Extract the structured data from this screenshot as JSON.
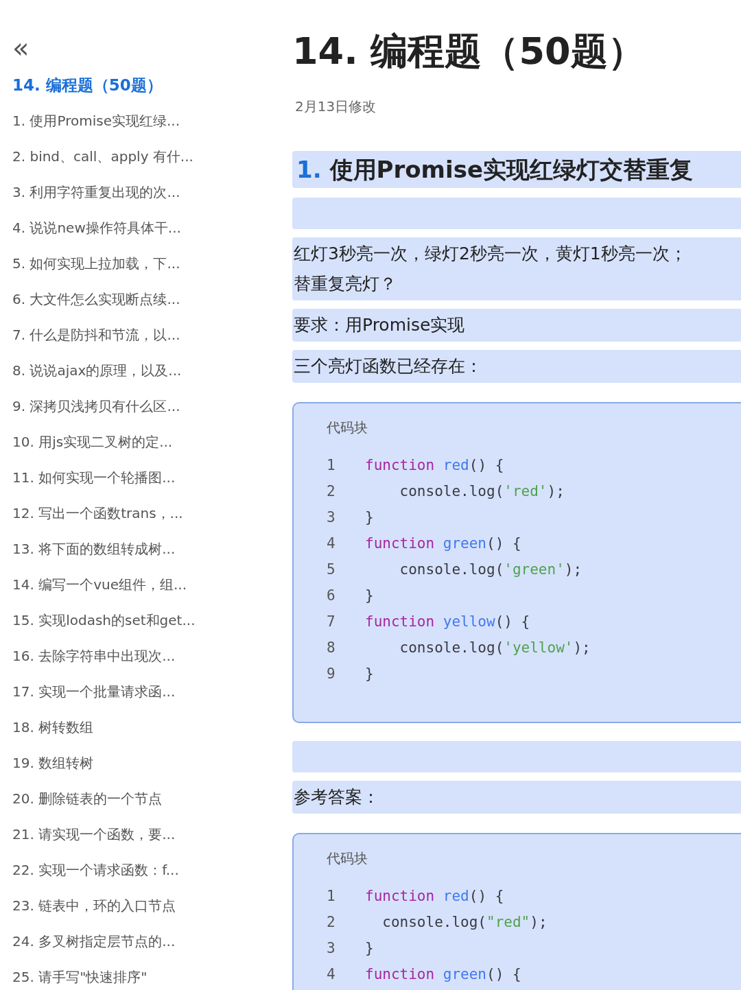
{
  "sidebar": {
    "collapse_icon": "«",
    "title": "14. 编程题（50题）",
    "items": [
      {
        "label": "1. 使用Promise实现红绿...",
        "selected": false
      },
      {
        "label": "2. bind、call、apply 有什...",
        "selected": false
      },
      {
        "label": "3. 利用字符重复出现的次...",
        "selected": false
      },
      {
        "label": "4. 说说new操作符具体干...",
        "selected": false
      },
      {
        "label": "5. 如何实现上拉加载，下...",
        "selected": false
      },
      {
        "label": "6. 大文件怎么实现断点续...",
        "selected": false
      },
      {
        "label": "7. 什么是防抖和节流，以...",
        "selected": false
      },
      {
        "label": "8. 说说ajax的原理，以及...",
        "selected": false
      },
      {
        "label": "9. 深拷贝浅拷贝有什么区...",
        "selected": false
      },
      {
        "label": "10. 用js实现二叉树的定...",
        "selected": false
      },
      {
        "label": "11. 如何实现一个轮播图...",
        "selected": false
      },
      {
        "label": "12. 写出一个函数trans，...",
        "selected": false
      },
      {
        "label": "13. 将下面的数组转成树...",
        "selected": false
      },
      {
        "label": "14. 编写一个vue组件，组...",
        "selected": false
      },
      {
        "label": "15. 实现lodash的set和get...",
        "selected": false
      },
      {
        "label": "16. 去除字符串中出现次...",
        "selected": false
      },
      {
        "label": "17. 实现一个批量请求函...",
        "selected": false
      },
      {
        "label": "18. 树转数组",
        "selected": false
      },
      {
        "label": "19. 数组转树",
        "selected": false
      },
      {
        "label": "20. 删除链表的一个节点",
        "selected": false
      },
      {
        "label": "21. 请实现一个函数，要...",
        "selected": false
      },
      {
        "label": "22. 实现一个请求函数：f...",
        "selected": false
      },
      {
        "label": "23. 链表中，环的入口节点",
        "selected": false
      },
      {
        "label": "24. 多叉树指定层节点的...",
        "selected": false
      },
      {
        "label": "25. 请手写\"快速排序\"",
        "selected": false
      }
    ]
  },
  "document": {
    "title": "14. 编程题（50题）",
    "modified": "2月13日修改",
    "blocks": [
      {
        "kind": "heading",
        "number": "1.",
        "text": "使用Promise实现红绿灯交替重复"
      },
      {
        "kind": "empty"
      },
      {
        "kind": "paragraph",
        "lines": [
          "红灯3秒亮一次，绿灯2秒亮一次，黄灯1秒亮一次；",
          "替重复亮灯？"
        ]
      },
      {
        "kind": "paragraph",
        "lines": [
          "要求：用Promise实现"
        ]
      },
      {
        "kind": "paragraph",
        "lines": [
          "三个亮灯函数已经存在："
        ]
      },
      {
        "kind": "code",
        "label": "代码块",
        "lines": [
          {
            "number": "1",
            "tokens": [
              {
                "text": "function ",
                "kind": "keyword"
              },
              {
                "text": "red",
                "kind": "name"
              },
              {
                "text": "() {",
                "kind": "plain"
              }
            ]
          },
          {
            "number": "2",
            "tokens": [
              {
                "text": "    console.log(",
                "kind": "plain"
              },
              {
                "text": "'red'",
                "kind": "string"
              },
              {
                "text": ");",
                "kind": "plain"
              }
            ]
          },
          {
            "number": "3",
            "tokens": [
              {
                "text": "}",
                "kind": "plain"
              }
            ]
          },
          {
            "number": "4",
            "tokens": [
              {
                "text": "function ",
                "kind": "keyword"
              },
              {
                "text": "green",
                "kind": "name"
              },
              {
                "text": "() {",
                "kind": "plain"
              }
            ]
          },
          {
            "number": "5",
            "tokens": [
              {
                "text": "    console.log(",
                "kind": "plain"
              },
              {
                "text": "'green'",
                "kind": "string"
              },
              {
                "text": ");",
                "kind": "plain"
              }
            ]
          },
          {
            "number": "6",
            "tokens": [
              {
                "text": "}",
                "kind": "plain"
              }
            ]
          },
          {
            "number": "7",
            "tokens": [
              {
                "text": "function ",
                "kind": "keyword"
              },
              {
                "text": "yellow",
                "kind": "name"
              },
              {
                "text": "() {",
                "kind": "plain"
              }
            ]
          },
          {
            "number": "8",
            "tokens": [
              {
                "text": "    console.log(",
                "kind": "plain"
              },
              {
                "text": "'yellow'",
                "kind": "string"
              },
              {
                "text": ");",
                "kind": "plain"
              }
            ]
          },
          {
            "number": "9",
            "tokens": [
              {
                "text": "}",
                "kind": "plain"
              }
            ]
          }
        ]
      },
      {
        "kind": "empty"
      },
      {
        "kind": "paragraph",
        "lines": [
          "参考答案："
        ]
      },
      {
        "kind": "code",
        "label": "代码块",
        "lines": [
          {
            "number": "1",
            "tokens": [
              {
                "text": "function ",
                "kind": "keyword"
              },
              {
                "text": "red",
                "kind": "name"
              },
              {
                "text": "() {",
                "kind": "plain"
              }
            ]
          },
          {
            "number": "2",
            "tokens": [
              {
                "text": "  console.log(",
                "kind": "plain"
              },
              {
                "text": "\"red\"",
                "kind": "string"
              },
              {
                "text": ");",
                "kind": "plain"
              }
            ]
          },
          {
            "number": "3",
            "tokens": [
              {
                "text": "}",
                "kind": "plain"
              }
            ]
          },
          {
            "number": "4",
            "tokens": [
              {
                "text": "function ",
                "kind": "keyword"
              },
              {
                "text": "green",
                "kind": "name"
              },
              {
                "text": "() {",
                "kind": "plain"
              }
            ]
          }
        ]
      }
    ]
  }
}
